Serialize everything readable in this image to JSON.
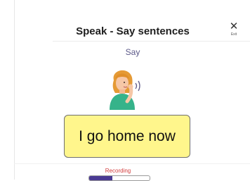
{
  "header": {
    "title": "Speak - Say sentences",
    "exit_label": "Exit",
    "exit_icon": "close-icon"
  },
  "prompt": {
    "label": "Say"
  },
  "illustration": {
    "icon": "speaking-person-icon"
  },
  "sentence": {
    "text": "I go home now"
  },
  "recording": {
    "label": "Recording",
    "progress": 0.38
  },
  "colors": {
    "accent": "#4a3a93",
    "card": "#fff68c",
    "recording": "#d23b3b",
    "say_label": "#5b5888"
  }
}
